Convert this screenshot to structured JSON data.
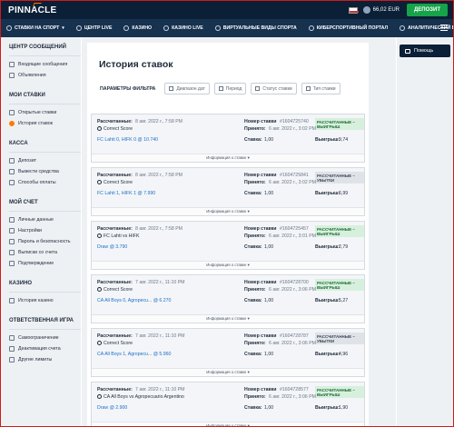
{
  "brand": {
    "name": "PINNACLE"
  },
  "topbar": {
    "balance": "66,02 EUR",
    "deposit_label": "ДЕПОЗИТ"
  },
  "nav": {
    "items": [
      {
        "label": "СТАВКИ НА СПОРТ",
        "caret": true
      },
      {
        "label": "ЦЕНТР LIVE",
        "caret": false
      },
      {
        "label": "КАЗИНО",
        "caret": false
      },
      {
        "label": "КАЗИНО LIVE",
        "caret": false
      },
      {
        "label": "ВИРТУАЛЬНЫЕ ВИДЫ СПОРТА",
        "caret": false
      },
      {
        "label": "КИБЕРСПОРТИВНЫЙ ПОРТАЛ",
        "caret": false
      },
      {
        "label": "АНАЛИТИЧЕСКИЙ БЛОГ",
        "caret": false
      }
    ]
  },
  "sidebar": {
    "groups": [
      {
        "title": "ЦЕНТР СООБЩЕНИЙ",
        "items": [
          "Входящие сообщения",
          "Объявления"
        ]
      },
      {
        "title": "МОИ СТАВКИ",
        "items": [
          "Открытые ставки",
          "История ставок"
        ]
      },
      {
        "title": "КАССА",
        "items": [
          "Депозит",
          "Вывести средства",
          "Способы оплаты"
        ]
      },
      {
        "title": "МОЙ СЧЕТ",
        "items": [
          "Личные данные",
          "Настройки",
          "Пароль и безопасность",
          "Выписки со счета",
          "Подтверждение"
        ]
      },
      {
        "title": "КАЗИНО",
        "items": [
          "История казино"
        ]
      },
      {
        "title": "ОТВЕТСТВЕННАЯ ИГРА",
        "items": [
          "Самоограничение",
          "Деактивация счета",
          "Другие лимиты"
        ]
      }
    ],
    "active": "История ставок"
  },
  "main": {
    "title": "История ставок",
    "filter_label": "ПАРАМЕТРЫ ФИЛЬТРА",
    "filters": [
      "Диапазон дат",
      "Период",
      "Статус ставки",
      "Тип ставки"
    ]
  },
  "labels": {
    "settled": "Рассчитанные:",
    "bet_number": "Номер ставки",
    "accepted": "Принято:",
    "stake": "Ставка:",
    "winnings": "Выигрыш:",
    "info": "Информация о ставке"
  },
  "bets": [
    {
      "settled": "8 авг. 2022 г., 7:58 PM",
      "number": "#1604725740",
      "status": "РАССЧИТАННЫЕ – ВЫИГРЫШ",
      "won": true,
      "market": "Correct Score",
      "accepted": "6 авг. 2022 г., 3:02 PM",
      "selection": "FC Lahti 0, HIFK 0",
      "odds": "@ 10.740",
      "stake": "1,00",
      "winnings": "9,74"
    },
    {
      "settled": "8 авг. 2022 г., 7:58 PM",
      "number": "#1604725841",
      "status": "РАССЧИТАННЫЕ – УБЫТКИ",
      "won": false,
      "market": "Correct Score",
      "accepted": "6 авг. 2022 г., 3:02 PM",
      "selection": "FC Lahti 1, HIFK 1",
      "odds": "@ 7.990",
      "stake": "1,00",
      "winnings": "6,99"
    },
    {
      "settled": "8 авг. 2022 г., 7:58 PM",
      "number": "#1604725457",
      "status": "РАССЧИТАННЫЕ – ВЫИГРЫШ",
      "won": true,
      "market": "FC Lahti vs HIFK",
      "accepted": "6 авг. 2022 г., 3:01 PM",
      "selection": "Draw",
      "odds": "@ 3.790",
      "stake": "1,00",
      "winnings": "2,79"
    },
    {
      "settled": "7 авг. 2022 г., 11:10 PM",
      "number": "#1604728700",
      "status": "РАССЧИТАННЫЕ – ВЫИГРЫШ",
      "won": true,
      "market": "Correct Score",
      "accepted": "6 авг. 2022 г., 3:06 PM",
      "selection": "CA All Boys 0, Agropecu...",
      "odds": "@ 6.270",
      "stake": "1,00",
      "winnings": "5,27"
    },
    {
      "settled": "7 авг. 2022 г., 11:10 PM",
      "number": "#1604728787",
      "status": "РАССЧИТАННЫЕ – УБЫТКИ",
      "won": false,
      "market": "Correct Score",
      "accepted": "6 авг. 2022 г., 3:06 PM",
      "selection": "CA All Boys 1, Agropecu...",
      "odds": "@ 5.960",
      "stake": "1,00",
      "winnings": "4,96"
    },
    {
      "settled": "7 авг. 2022 г., 11:10 PM",
      "number": "#1604728577",
      "status": "РАССЧИТАННЫЕ – ВЫИГРЫШ",
      "won": true,
      "market": "CA All Boys vs Agropecuario Argentino",
      "accepted": "6 авг. 2022 г., 3:06 PM",
      "selection": "Draw",
      "odds": "@ 2.900",
      "stake": "1,00",
      "winnings": "1,90"
    }
  ],
  "right": {
    "help_label": "Помощь"
  }
}
